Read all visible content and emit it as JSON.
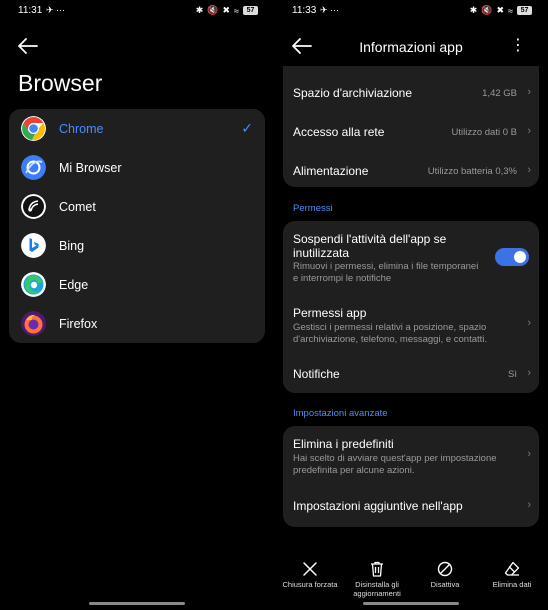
{
  "left": {
    "status": {
      "time": "11:31",
      "battery": "57"
    },
    "title": "Browser",
    "selected_color": "#4a8cff",
    "browsers": [
      {
        "label": "Chrome",
        "icon": "chrome-icon",
        "selected": true
      },
      {
        "label": "Mi Browser",
        "icon": "mi-browser-icon",
        "selected": false
      },
      {
        "label": "Comet",
        "icon": "comet-icon",
        "selected": false
      },
      {
        "label": "Bing",
        "icon": "bing-icon",
        "selected": false
      },
      {
        "label": "Edge",
        "icon": "edge-icon",
        "selected": false
      },
      {
        "label": "Firefox",
        "icon": "firefox-icon",
        "selected": false
      }
    ]
  },
  "right": {
    "status": {
      "time": "11:33",
      "battery": "57"
    },
    "title": "Informazioni app",
    "storage": {
      "label": "Spazio d'archiviazione",
      "value": "1,42 GB"
    },
    "network": {
      "label": "Accesso alla rete",
      "value": "Utilizzo dati 0 B"
    },
    "power": {
      "label": "Alimentazione",
      "value": "Utilizzo batteria 0,3%"
    },
    "permissions_section": "Permessi",
    "suspend": {
      "title_line1": "Sospendi l'attività dell'app se",
      "title_line2": "inutilizzata",
      "desc_line1": "Rimuovi i permessi, elimina i file temporanei",
      "desc_line2": "e interrompi le notifiche",
      "enabled": true
    },
    "app_permissions": {
      "title": "Permessi app",
      "desc_line1": "Gestisci i permessi relativi a posizione, spazio",
      "desc_line2": "d'archiviazione, telefono, messaggi, e contatti."
    },
    "notifications": {
      "label": "Notifiche",
      "value": "Sì"
    },
    "advanced_section": "Impostazioni avanzate",
    "defaults": {
      "title": "Elimina i predefiniti",
      "desc_line1": "Hai scelto di avviare quest'app per impostazione",
      "desc_line2": "predefinita per alcune azioni."
    },
    "extra_settings": {
      "label": "Impostazioni aggiuntive nell'app"
    },
    "actions": [
      {
        "label_line1": "Chiusura forzata",
        "label_line2": "",
        "icon": "close-icon"
      },
      {
        "label_line1": "Disinstalla gli",
        "label_line2": "aggiornamenti",
        "icon": "trash-icon"
      },
      {
        "label_line1": "Disattiva",
        "label_line2": "",
        "icon": "disable-icon"
      },
      {
        "label_line1": "Elimina dati",
        "label_line2": "",
        "icon": "eraser-icon"
      }
    ],
    "toggle_color": "#3c72e6"
  }
}
